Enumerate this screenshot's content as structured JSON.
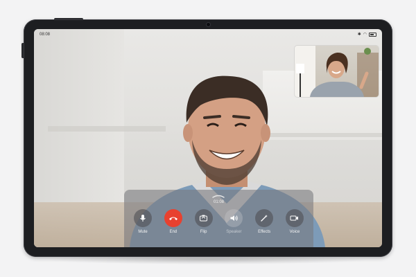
{
  "status_bar": {
    "time": "08:08"
  },
  "call": {
    "duration": "01:08"
  },
  "controls": [
    {
      "label": "Mute",
      "icon": "microphone-icon"
    },
    {
      "label": "End",
      "icon": "hang-up-icon",
      "color": "#e8412f"
    },
    {
      "label": "Flip",
      "icon": "flip-camera-icon"
    },
    {
      "label": "Speaker",
      "icon": "speaker-icon",
      "disabled": true
    },
    {
      "label": "Effects",
      "icon": "magic-wand-icon"
    },
    {
      "label": "Voice",
      "icon": "voice-call-icon"
    }
  ]
}
